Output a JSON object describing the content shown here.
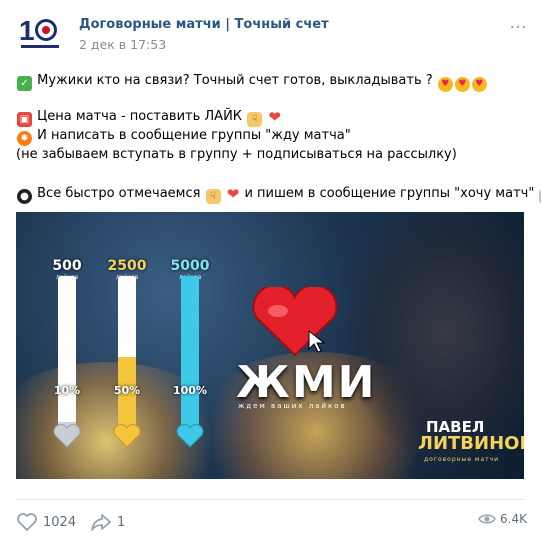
{
  "post": {
    "author": "Договорные матчи | Точный счет",
    "date": "2 дек в 17:53",
    "more_glyph": "···",
    "lines": {
      "l1": "Мужики кто на связи? Точный счет готов, выкладывать ?",
      "l2": "Цена матча - поставить ЛАЙК",
      "l3": "И написать в сообщение группы \"жду матча\"",
      "l4": "(не забываем вступать в группу + подписываться на рассылку)",
      "l5a": "Все быстро отмечаемся",
      "l5b": "и пишем в сообщение группы \"хочу матч\""
    }
  },
  "promo": {
    "bars": [
      {
        "label": "500",
        "sub": "лайков",
        "percent": "10%",
        "fill": 0.1,
        "color": "#cfd3d8"
      },
      {
        "label": "2500",
        "sub": "лайков",
        "percent": "50%",
        "fill": 0.5,
        "color": "#f2c53d"
      },
      {
        "label": "5000",
        "sub": "лайков",
        "percent": "100%",
        "fill": 1.0,
        "color": "#3ec9e8"
      }
    ],
    "title": "ЖМИ",
    "subtitle": "ждем ваших лайков",
    "name_first": "ПАВЕЛ",
    "name_last": "ЛИТВИНОВ",
    "name_sub": "договорные матчи"
  },
  "actions": {
    "likes": "1024",
    "shares": "1",
    "views": "6.4K"
  },
  "colors": {
    "link": "#2a5885",
    "muted": "#818c99",
    "icon": "#99a2ad"
  }
}
